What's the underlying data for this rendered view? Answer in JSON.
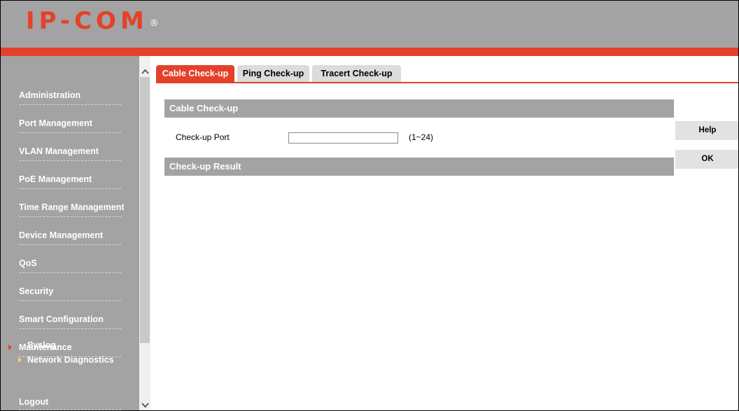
{
  "header": {
    "logo": "IP-COM",
    "logo_mark": "®"
  },
  "sidebar": {
    "items": [
      {
        "label": "Administration"
      },
      {
        "label": "Port Management"
      },
      {
        "label": "VLAN Management"
      },
      {
        "label": "PoE Management"
      },
      {
        "label": "Time Range Management"
      },
      {
        "label": "Device Management"
      },
      {
        "label": "QoS"
      },
      {
        "label": "Security"
      },
      {
        "label": "Smart Configuration"
      },
      {
        "label": "Maintenance",
        "active": true
      }
    ],
    "subitems": [
      {
        "label": "Syslog"
      },
      {
        "label": "Network Diagnostics",
        "active": true
      }
    ],
    "logout": "Logout"
  },
  "tabs": [
    {
      "label": "Cable Check-up",
      "active": true
    },
    {
      "label": "Ping Check-up"
    },
    {
      "label": "Tracert Check-up"
    }
  ],
  "cable_section": {
    "title": "Cable Check-up",
    "port_label": "Check-up Port",
    "port_value": "",
    "port_range": "(1~24)"
  },
  "result_section": {
    "title": "Check-up Result"
  },
  "buttons": {
    "help": "Help",
    "ok": "OK"
  },
  "colors": {
    "brand_red": "#e4412a",
    "sidebar_gray": "#a3a3a3",
    "active_sub_arrow": "#f6d45a"
  },
  "icons": {
    "scroll_up": "chevron-up-icon",
    "scroll_down": "chevron-down-icon",
    "active_marker": "triangle-right-icon"
  }
}
